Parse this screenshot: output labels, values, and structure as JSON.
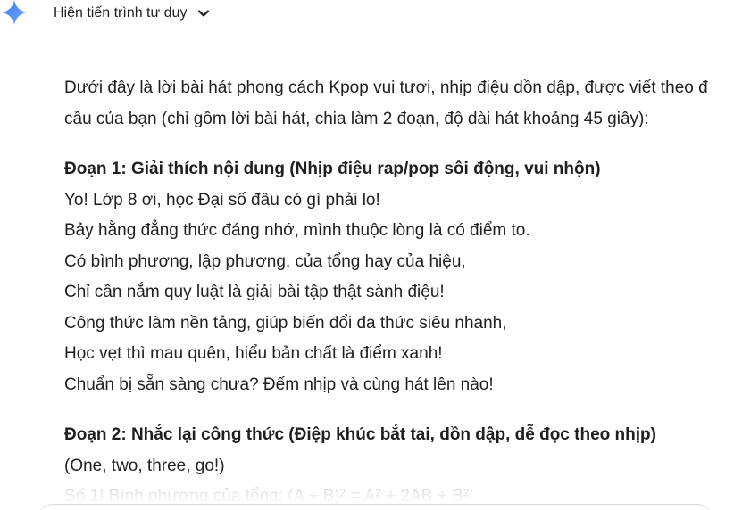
{
  "header": {
    "icon": "gemini-spark-icon",
    "show_thinking_label": "Hiện tiến trình tư duy",
    "toggle_icon": "chevron-down-icon"
  },
  "response": {
    "intro_lines": [
      "Dưới đây là lời bài hát phong cách Kpop vui tươi, nhịp điệu dồn dập, được viết theo đ",
      "cầu của bạn (chỉ gồm lời bài hát, chia làm 2 đoạn, độ dài hát khoảng 45 giây):"
    ],
    "verse1": {
      "heading": "Đoạn 1: Giải thích nội dung (Nhịp điệu rap/pop sôi động, vui nhộn)",
      "lines": [
        "Yo! Lớp 8 ơi, học Đại số đâu có gì phải lo!",
        "Bảy hằng đẳng thức đáng nhớ, mình thuộc lòng là có điểm to.",
        "Có bình phương, lập phương, của tổng hay của hiệu,",
        "Chỉ cần nắm quy luật là giải bài tập thật sành điệu!",
        "Công thức làm nền tảng, giúp biến đổi đa thức siêu nhanh,",
        "Học vẹt thì mau quên, hiểu bản chất là điểm xanh!",
        "Chuẩn bị sẵn sàng chưa? Đếm nhịp và cùng hát lên nào!"
      ]
    },
    "verse2": {
      "heading": "Đoạn 2: Nhắc lại công thức (Điệp khúc bắt tai, dồn dập, dễ đọc theo nhịp)",
      "lines": [
        "(One, two, three, go!)",
        "Số 1! Bình phương của tổng: (A + B)² = A² + 2AB + B²!"
      ]
    }
  },
  "colors": {
    "text": "#1f1f1f",
    "faded_text": "#b4b4b4",
    "spark_blue": "#4a8ff5",
    "background": "#ffffff"
  }
}
